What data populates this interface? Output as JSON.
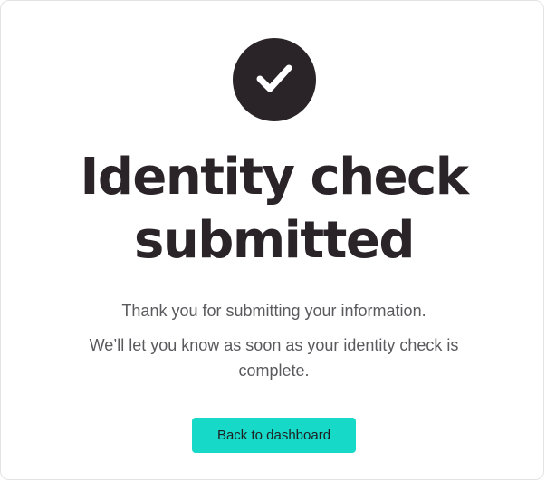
{
  "title": {
    "line1": "Identity check",
    "line2": "submitted"
  },
  "messages": {
    "thanks": "Thank you for submitting your information.",
    "notice": "We’ll let you know as soon as your identity check is complete."
  },
  "actions": {
    "back_label": "Back to dashboard"
  },
  "icons": {
    "status": "check-icon"
  },
  "colors": {
    "primary_dark": "#2a2428",
    "accent": "#16d9c8",
    "body_text": "#5a5a5e"
  }
}
